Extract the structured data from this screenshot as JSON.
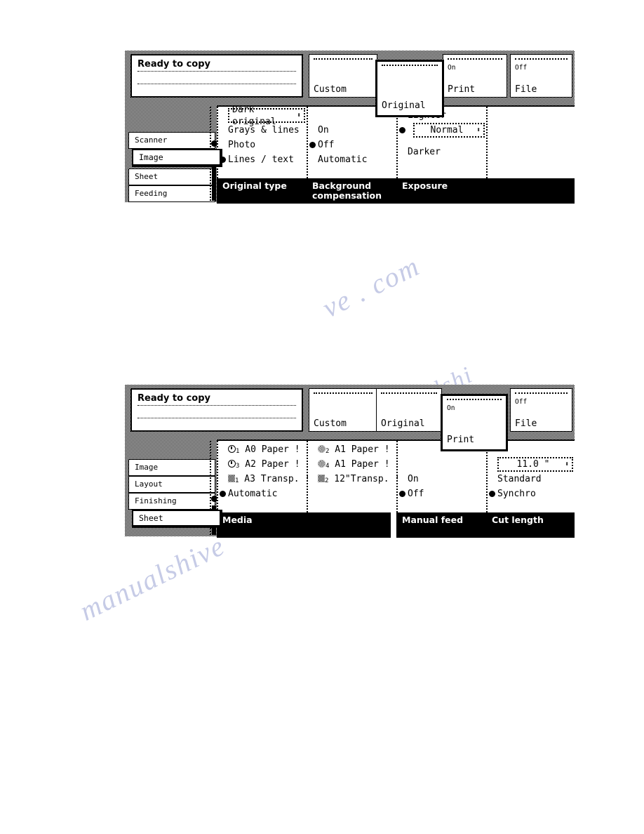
{
  "panels": [
    {
      "status": {
        "title": "Ready to copy"
      },
      "tabs": [
        {
          "name": "custom",
          "top_label": "",
          "label": "Custom",
          "selected": false
        },
        {
          "name": "original",
          "top_label": "",
          "label": "Original",
          "selected": true
        },
        {
          "name": "print",
          "top_label": "On",
          "label": "Print",
          "selected": false
        },
        {
          "name": "file",
          "top_label": "Off",
          "label": "File",
          "selected": false
        }
      ],
      "sidebar": {
        "items": [
          {
            "label": "Scanner",
            "selected": false
          },
          {
            "label": "Image",
            "selected": true
          },
          {
            "label": "Sheet",
            "selected": false
          },
          {
            "label": "Feeding",
            "selected": false
          }
        ]
      },
      "columns": [
        {
          "header": "Original type",
          "spinner": {
            "value": "Dark original",
            "arrows": "⬍"
          },
          "options": [
            {
              "label": "Grays & lines",
              "selected": false
            },
            {
              "label": "Photo",
              "selected": false
            },
            {
              "label": "Lines / text",
              "selected": true
            }
          ]
        },
        {
          "header": "Background compensation",
          "header_line1": "Background",
          "header_line2": "compensation",
          "options": [
            {
              "label": "On",
              "selected": false
            },
            {
              "label": "Off",
              "selected": true
            },
            {
              "label": "Automatic",
              "selected": false
            }
          ]
        },
        {
          "header": "Exposure",
          "options_top": [
            {
              "label": "Lighter",
              "selected": false
            }
          ],
          "spinner": {
            "value": "Normal",
            "arrows": "⬍",
            "selected": true
          },
          "options_bottom": [
            {
              "label": "Darker",
              "selected": false
            }
          ]
        },
        {
          "header": ""
        }
      ]
    },
    {
      "status": {
        "title": "Ready to copy"
      },
      "tabs": [
        {
          "name": "custom",
          "top_label": "",
          "label": "Custom",
          "selected": false
        },
        {
          "name": "original",
          "top_label": "",
          "label": "Original",
          "selected": false
        },
        {
          "name": "print",
          "top_label": "On",
          "label": "Print",
          "selected": true
        },
        {
          "name": "file",
          "top_label": "Off",
          "label": "File",
          "selected": false
        }
      ],
      "sidebar": {
        "items": [
          {
            "label": "Image",
            "selected": false
          },
          {
            "label": "Layout",
            "selected": false
          },
          {
            "label": "Finishing",
            "selected": false
          },
          {
            "label": "Sheet",
            "selected": true
          }
        ]
      },
      "media": {
        "header": "Media",
        "col_a": [
          {
            "icon": "roll-icon",
            "num": "1",
            "label": "A0 Paper !",
            "dim": false
          },
          {
            "icon": "roll-icon",
            "num": "3",
            "label": "A2 Paper !",
            "dim": false
          },
          {
            "icon": "sheet-icon",
            "num": "1",
            "label": "A3 Transp. !",
            "dim": true
          },
          {
            "icon": "",
            "num": "",
            "label": "Automatic",
            "dim": false,
            "selected": true
          }
        ],
        "col_b": [
          {
            "icon": "roll-icon",
            "num": "2",
            "label": "A1 Paper !",
            "dim": true
          },
          {
            "icon": "roll-icon",
            "num": "4",
            "label": "A1 Paper !",
            "dim": true
          },
          {
            "icon": "sheet-icon",
            "num": "2",
            "label": "12\"Transp. !",
            "dim": true
          }
        ]
      },
      "manual_feed": {
        "header": "Manual feed",
        "options": [
          {
            "label": "On",
            "selected": false
          },
          {
            "label": "Off",
            "selected": true
          }
        ]
      },
      "cut_length": {
        "header": "Cut length",
        "spinner": {
          "value": "11.0 \"",
          "arrows": "⬍"
        },
        "options": [
          {
            "label": "Standard",
            "selected": false
          },
          {
            "label": "Synchro",
            "selected": true
          }
        ]
      }
    }
  ],
  "watermarks": [
    "ve . com",
    "manualshive",
    "alshi",
    "ualshi"
  ]
}
